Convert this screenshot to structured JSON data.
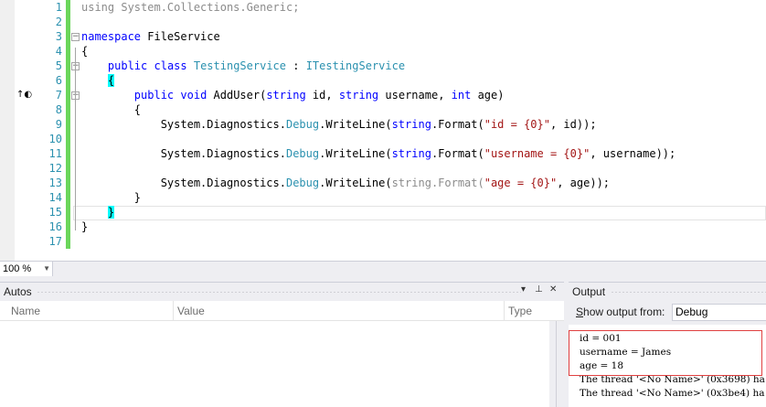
{
  "editor": {
    "lines": [
      {
        "n": "1",
        "segs": [
          {
            "t": "using System.Collections.Generic;",
            "c": "dim"
          }
        ]
      },
      {
        "n": "2",
        "segs": []
      },
      {
        "n": "3",
        "segs": [
          {
            "t": "namespace",
            "c": "kw"
          },
          {
            "t": " FileService",
            "c": ""
          }
        ]
      },
      {
        "n": "4",
        "segs": [
          {
            "t": "{",
            "c": ""
          }
        ]
      },
      {
        "n": "5",
        "segs": [
          {
            "t": "    ",
            "c": ""
          },
          {
            "t": "public",
            "c": "kw"
          },
          {
            "t": " ",
            "c": ""
          },
          {
            "t": "class",
            "c": "kw"
          },
          {
            "t": " ",
            "c": ""
          },
          {
            "t": "TestingService",
            "c": "ty"
          },
          {
            "t": " : ",
            "c": ""
          },
          {
            "t": "ITestingService",
            "c": "ty"
          }
        ]
      },
      {
        "n": "6",
        "segs": [
          {
            "t": "    ",
            "c": ""
          },
          {
            "t": "{",
            "c": "brace-hl"
          }
        ]
      },
      {
        "n": "7",
        "segs": [
          {
            "t": "        ",
            "c": ""
          },
          {
            "t": "public",
            "c": "kw"
          },
          {
            "t": " ",
            "c": ""
          },
          {
            "t": "void",
            "c": "kw"
          },
          {
            "t": " AddUser(",
            "c": ""
          },
          {
            "t": "string",
            "c": "kw"
          },
          {
            "t": " id, ",
            "c": ""
          },
          {
            "t": "string",
            "c": "kw"
          },
          {
            "t": " username, ",
            "c": ""
          },
          {
            "t": "int",
            "c": "kw"
          },
          {
            "t": " age)",
            "c": ""
          }
        ]
      },
      {
        "n": "8",
        "segs": [
          {
            "t": "        {",
            "c": ""
          }
        ]
      },
      {
        "n": "9",
        "segs": [
          {
            "t": "            System.Diagnostics.",
            "c": ""
          },
          {
            "t": "Debug",
            "c": "ty"
          },
          {
            "t": ".WriteLine(",
            "c": ""
          },
          {
            "t": "string",
            "c": "kw"
          },
          {
            "t": ".Format(",
            "c": ""
          },
          {
            "t": "\"id = {0}\"",
            "c": "st"
          },
          {
            "t": ", id));",
            "c": ""
          }
        ]
      },
      {
        "n": "10",
        "segs": []
      },
      {
        "n": "11",
        "segs": [
          {
            "t": "            System.Diagnostics.",
            "c": ""
          },
          {
            "t": "Debug",
            "c": "ty"
          },
          {
            "t": ".WriteLine(",
            "c": ""
          },
          {
            "t": "string",
            "c": "kw"
          },
          {
            "t": ".Format(",
            "c": ""
          },
          {
            "t": "\"username = {0}\"",
            "c": "st"
          },
          {
            "t": ", username));",
            "c": ""
          }
        ]
      },
      {
        "n": "12",
        "segs": []
      },
      {
        "n": "13",
        "segs": [
          {
            "t": "            System.Diagnostics.",
            "c": ""
          },
          {
            "t": "Debug",
            "c": "ty"
          },
          {
            "t": ".WriteLine(",
            "c": ""
          },
          {
            "t": "string",
            "c": "dim"
          },
          {
            "t": ".Format(",
            "c": "dim"
          },
          {
            "t": "\"age = {0}\"",
            "c": "st"
          },
          {
            "t": ", age));",
            "c": ""
          }
        ]
      },
      {
        "n": "14",
        "segs": [
          {
            "t": "        }",
            "c": ""
          }
        ]
      },
      {
        "n": "15",
        "segs": [
          {
            "t": "    ",
            "c": ""
          },
          {
            "t": "}",
            "c": "brace-hl"
          }
        ]
      },
      {
        "n": "16",
        "segs": [
          {
            "t": "}",
            "c": ""
          }
        ]
      },
      {
        "n": "17",
        "segs": []
      }
    ]
  },
  "zoom": {
    "value": "100 %"
  },
  "autos": {
    "title": "Autos",
    "columns": [
      "Name",
      "Value",
      "Type"
    ]
  },
  "output": {
    "title": "Output",
    "show_label_underlined": "S",
    "show_label_rest": "how output from:",
    "source": "Debug",
    "lines": [
      "id = 001",
      "username = James",
      "age = 18",
      "The thread '<No Name>' (0x3698) ha",
      "The thread '<No Name>' (0x3be4) ha"
    ]
  },
  "colors": {
    "keyword": "#0000ff",
    "type": "#2b91af",
    "string": "#a31515",
    "change_bar": "#6bd65b",
    "brace_highlight": "#00ffff",
    "output_highlight": "#e04040"
  }
}
